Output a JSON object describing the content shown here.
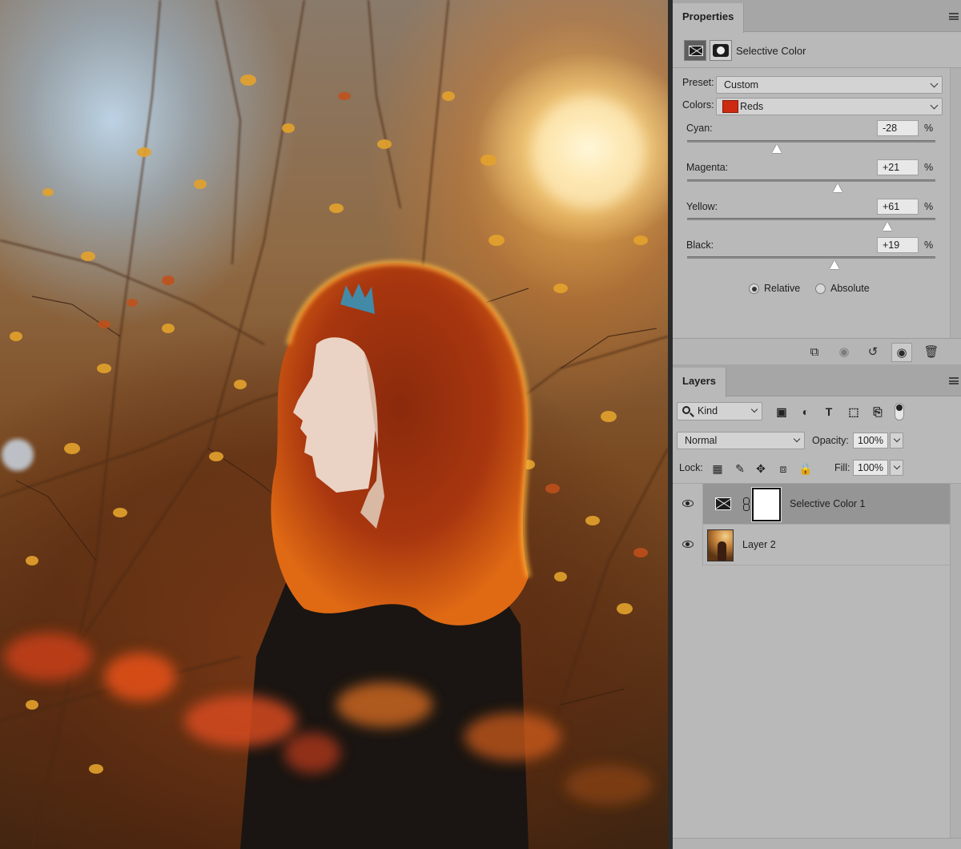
{
  "properties": {
    "tab_label": "Properties",
    "adjustment_name": "Selective Color",
    "preset_label": "Preset:",
    "preset_value": "Custom",
    "colors_label": "Colors:",
    "colors_value": "Reds",
    "colors_swatch": "#cc2a12",
    "sliders": [
      {
        "label": "Cyan:",
        "value": "-28",
        "unit": "%",
        "level": -28
      },
      {
        "label": "Magenta:",
        "value": "+21",
        "unit": "%",
        "level": 21
      },
      {
        "label": "Yellow:",
        "value": "+61",
        "unit": "%",
        "level": 61
      },
      {
        "label": "Black:",
        "value": "+19",
        "unit": "%",
        "level": 19
      }
    ],
    "method_options": [
      "Relative",
      "Absolute"
    ],
    "method_selected": "Relative",
    "footer_icons": [
      "clip-to-layer-icon",
      "view-previous-state-icon",
      "reset-icon",
      "visibility-icon",
      "delete-icon"
    ]
  },
  "layers": {
    "tab_label": "Layers",
    "filter_kind": "Kind",
    "filter_icons": [
      "pixel-layer-filter-icon",
      "adjustment-layer-filter-icon",
      "type-layer-filter-icon",
      "shape-layer-filter-icon",
      "smart-object-filter-icon"
    ],
    "blend_mode": "Normal",
    "opacity_label": "Opacity:",
    "opacity_value": "100%",
    "lock_label": "Lock:",
    "fill_label": "Fill:",
    "fill_value": "100%",
    "items": [
      {
        "name": "Selective Color 1",
        "type": "adjustment",
        "visible": true,
        "selected": true
      },
      {
        "name": "Layer 2",
        "type": "pixel",
        "visible": true,
        "selected": false
      }
    ]
  },
  "colors": {
    "panel_bg": "#b9b9b9",
    "selected_layer_bg": "#959595",
    "app_dark": "#535353"
  }
}
